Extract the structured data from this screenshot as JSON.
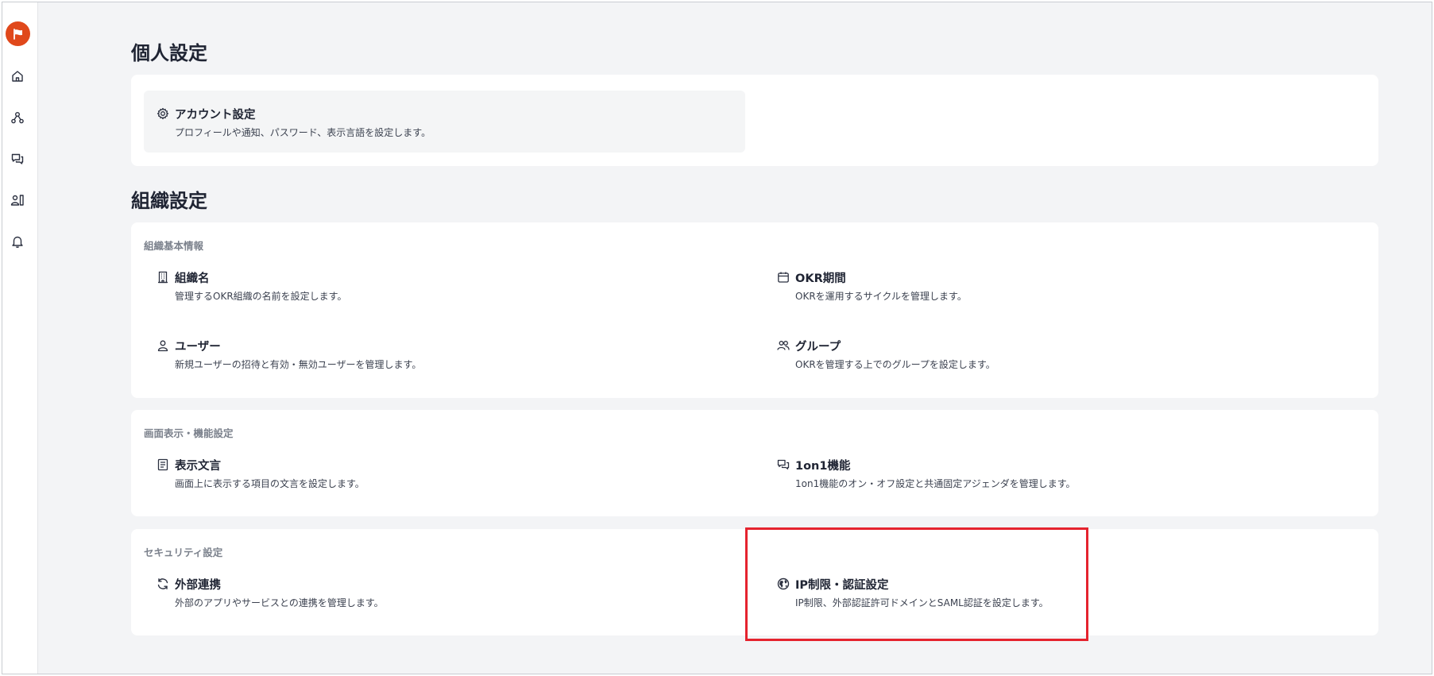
{
  "personal": {
    "title": "個人設定",
    "account": {
      "title": "アカウント設定",
      "desc": "プロフィールや通知、パスワード、表示言語を設定します。",
      "icon": "gear-icon"
    }
  },
  "org": {
    "title": "組織設定",
    "basic": {
      "label": "組織基本情報",
      "items": [
        {
          "title": "組織名",
          "desc": "管理するOKR組織の名前を設定します。",
          "icon": "building-icon"
        },
        {
          "title": "OKR期間",
          "desc": "OKRを運用するサイクルを管理します。",
          "icon": "calendar-icon"
        },
        {
          "title": "ユーザー",
          "desc": "新規ユーザーの招待と有効・無効ユーザーを管理します。",
          "icon": "user-icon"
        },
        {
          "title": "グループ",
          "desc": "OKRを管理する上でのグループを設定します。",
          "icon": "users-icon"
        }
      ]
    },
    "display": {
      "label": "画面表示・機能設定",
      "items": [
        {
          "title": "表示文言",
          "desc": "画面上に表示する項目の文言を設定します。",
          "icon": "document-icon"
        },
        {
          "title": "1on1機能",
          "desc": "1on1機能のオン・オフ設定と共通固定アジェンダを管理します。",
          "icon": "chat-icon"
        }
      ]
    },
    "security": {
      "label": "セキュリティ設定",
      "items": [
        {
          "title": "外部連携",
          "desc": "外部のアプリやサービスとの連携を管理します。",
          "icon": "sync-icon"
        },
        {
          "title": "IP制限・認証設定",
          "desc": "IP制限、外部認証許可ドメインとSAML認証を設定します。",
          "icon": "globe-icon"
        }
      ]
    }
  },
  "sidebar": {
    "icons": [
      "home-icon",
      "map-icon",
      "chat-icon",
      "user-book-icon",
      "bell-icon"
    ]
  },
  "colors": {
    "brand": "#e0481b",
    "highlight": "#e5232e",
    "background": "#f3f4f6"
  }
}
